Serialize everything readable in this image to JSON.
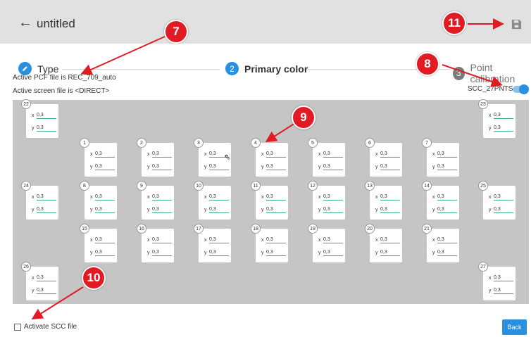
{
  "header": {
    "title": "untitled"
  },
  "steps": [
    {
      "number": "",
      "label": "Type",
      "state": "done",
      "color": "#2a8fdc"
    },
    {
      "number": "2",
      "label": "Primary color",
      "state": "active",
      "color": "#2a8fdc"
    },
    {
      "number": "3",
      "label": "Point calibration",
      "state": "inactive",
      "color": "#7a7a7a"
    }
  ],
  "info": {
    "pcf": "Active PCF file is REC_709_auto",
    "screen": "Active screen file is <DIRECT>"
  },
  "toggle": {
    "label": "SCC_27PNTS",
    "on": true
  },
  "cards": [
    {
      "id": "22",
      "x": "0,3",
      "y": "0,3"
    },
    {
      "id": "23",
      "x": "0,3",
      "y": "0,3"
    },
    {
      "id": "1",
      "x": "0,3",
      "y": "0,3"
    },
    {
      "id": "2",
      "x": "0,3",
      "y": "0,3"
    },
    {
      "id": "3",
      "x": "0,3",
      "y": "0,3"
    },
    {
      "id": "4",
      "x": "0,3",
      "y": "0,3"
    },
    {
      "id": "5",
      "x": "0,3",
      "y": "0,3"
    },
    {
      "id": "6",
      "x": "0,3",
      "y": "0,3"
    },
    {
      "id": "7",
      "x": "0,3",
      "y": "0,3"
    },
    {
      "id": "24",
      "x": "0,3",
      "y": "0,3"
    },
    {
      "id": "8",
      "x": "0,3",
      "y": "0,3"
    },
    {
      "id": "9",
      "x": "0,3",
      "y": "0,3"
    },
    {
      "id": "10",
      "x": "0,3",
      "y": "0,3"
    },
    {
      "id": "11",
      "x": "0,3",
      "y": "0,3"
    },
    {
      "id": "12",
      "x": "0,3",
      "y": "0,3"
    },
    {
      "id": "13",
      "x": "0,3",
      "y": "0,3"
    },
    {
      "id": "14",
      "x": "0,3",
      "y": "0,3"
    },
    {
      "id": "25",
      "x": "0,3",
      "y": "0,3"
    },
    {
      "id": "15",
      "x": "0,3",
      "y": "0,3"
    },
    {
      "id": "16",
      "x": "0,3",
      "y": "0,3"
    },
    {
      "id": "17",
      "x": "0,3",
      "y": "0,3"
    },
    {
      "id": "18",
      "x": "0,3",
      "y": "0,3"
    },
    {
      "id": "19",
      "x": "0,3",
      "y": "0,3"
    },
    {
      "id": "20",
      "x": "0,3",
      "y": "0,3"
    },
    {
      "id": "21",
      "x": "0,3",
      "y": "0,3"
    },
    {
      "id": "26",
      "x": "0,3",
      "y": "0,3"
    },
    {
      "id": "27",
      "x": "0,3",
      "y": "0,3"
    }
  ],
  "footer": {
    "checkbox_label": "Activate SCC file",
    "back_label": "Back"
  },
  "callouts": [
    "7",
    "8",
    "9",
    "10",
    "11"
  ],
  "colors": {
    "accent": "#2a8fdc",
    "callout": "#e01b24",
    "field_underline": "#3aa890",
    "grid_bg": "#c5c5c5",
    "header_bg": "#e1e1e1"
  }
}
